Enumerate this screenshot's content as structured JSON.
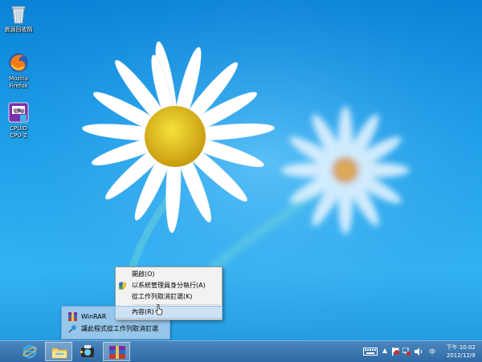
{
  "desktop": {
    "icons": [
      {
        "label": "資源回收筒",
        "icon": "recycle-bin-icon"
      },
      {
        "label_lines": [
          "Mozilla",
          "Firefox"
        ],
        "icon": "firefox-icon"
      },
      {
        "label_lines": [
          "CPUID",
          "CPU-Z"
        ],
        "icon": "cpu-z-icon"
      }
    ]
  },
  "context_menu": {
    "items": [
      {
        "label": "開啟(O)",
        "icon": ""
      },
      {
        "label": "以系統管理員身分執行(A)",
        "icon": "uac-shield-icon"
      },
      {
        "label": "從工作列取消釘選(K)",
        "icon": ""
      },
      {
        "label": "內容(R)",
        "icon": "",
        "selected": true
      }
    ]
  },
  "jump_list": {
    "items": [
      {
        "label": "WinRAR",
        "icon": "winrar-icon"
      },
      {
        "label": "讓此程式從工作列取消釘選",
        "icon": "unpin-icon"
      }
    ]
  },
  "taskbar": {
    "buttons": [
      {
        "name": "internet-explorer",
        "icon": "internet-explorer-icon",
        "active": false
      },
      {
        "name": "file-explorer",
        "icon": "folder-icon",
        "active": true
      },
      {
        "name": "cpu-z",
        "icon": "cpu-z-taskbar-icon",
        "active": false
      },
      {
        "name": "winrar",
        "icon": "winrar-taskbar-icon",
        "active": true
      }
    ],
    "tray": {
      "ime_label": "中",
      "time": "下午 10:02",
      "date": "2012/12/9"
    }
  }
}
